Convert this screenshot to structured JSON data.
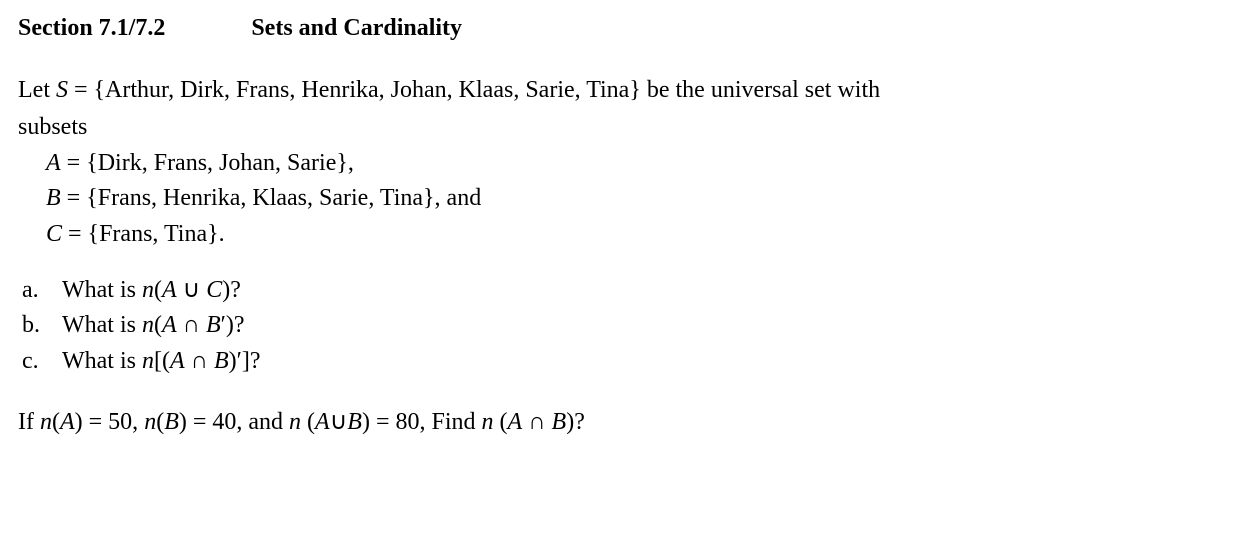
{
  "header": {
    "section": "Section 7.1/7.2",
    "title": "Sets and Cardinality"
  },
  "intro": {
    "let": "Let ",
    "S": "S",
    "eq": " = {Arthur, Dirk, Frans, Henrika, Johan, Klaas, Sarie, Tina} be the universal set with",
    "subsets": "subsets"
  },
  "sets": {
    "A_var": "A",
    "A_def": " = {Dirk, Frans, Johan, Sarie},",
    "B_var": "B",
    "B_def": " = {Frans, Henrika, Klaas, Sarie, Tina}, and",
    "C_var": "C",
    "C_def": " = {Frans, Tina}."
  },
  "questions": {
    "a_letter": "a.",
    "a_prefix": "What is ",
    "a_n": "n",
    "a_paren_open": "(",
    "a_A": "A",
    "a_op": " ∪ ",
    "a_C": "C",
    "a_paren_close": ")?",
    "b_letter": "b.",
    "b_prefix": "What is ",
    "b_n": "n",
    "b_paren_open": "(",
    "b_A": "A",
    "b_op": " ∩ ",
    "b_B": "B",
    "b_prime_close": "′)?",
    "c_letter": "c.",
    "c_prefix": "What is ",
    "c_n": "n",
    "c_bracket_open": "[(",
    "c_A": "A",
    "c_op": " ∩ ",
    "c_B": "B",
    "c_close": ")′]?"
  },
  "final": {
    "if": "If ",
    "n1": "n",
    "p1o": "(",
    "A1": "A",
    "p1c": ") = 50, ",
    "n2": "n",
    "p2o": "(",
    "B1": "B",
    "p2c": ") = 40, and ",
    "n3": "n",
    "sp3": " (",
    "A2": "A",
    "un": "∪",
    "B2": "B",
    "p3c": ") = 80, Find ",
    "n4": "n",
    "sp4": " (",
    "A3": "A",
    "int": " ∩ ",
    "B3": "B",
    "p4c": ")?"
  }
}
